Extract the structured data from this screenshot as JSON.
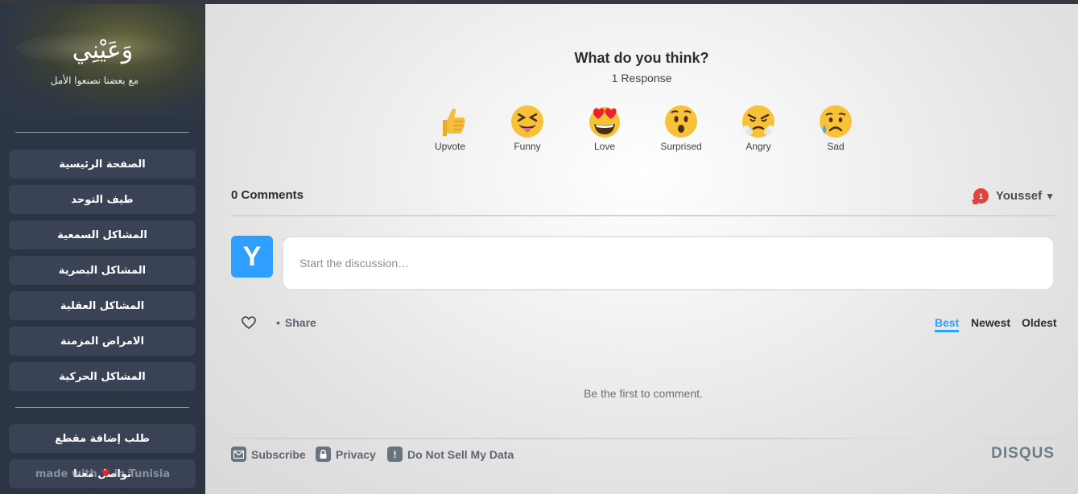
{
  "sidebar": {
    "brand": "وَعَيْنِي",
    "tagline": "مع بعضنا نصنعوا الأمل",
    "nav": [
      {
        "label": "الصفحة الرئيسية"
      },
      {
        "label": "طيف التوحد"
      },
      {
        "label": "المشاكل السمعية"
      },
      {
        "label": "المشاكل البصرية"
      },
      {
        "label": "المشاكل العقلية"
      },
      {
        "label": "الامراض المزمنة"
      },
      {
        "label": "المشاكل الحركية"
      }
    ],
    "request_clip": "طلب إضافة مقطع",
    "contact": "تواصل معنا",
    "made_with_prefix": "made with",
    "made_with_suffix": "in Tunisia"
  },
  "reactions_panel": {
    "question": "What do you think?",
    "responses": "1 Response",
    "reactions": [
      {
        "label": "Upvote",
        "icon": "thumbs-up-icon"
      },
      {
        "label": "Funny",
        "icon": "squinting-tongue-face-icon"
      },
      {
        "label": "Love",
        "icon": "heart-eyes-face-icon"
      },
      {
        "label": "Surprised",
        "icon": "hushed-face-icon"
      },
      {
        "label": "Angry",
        "icon": "steam-face-icon"
      },
      {
        "label": "Sad",
        "icon": "sad-sweat-face-icon"
      }
    ]
  },
  "comments": {
    "count_label": "0 Comments",
    "user_name": "Youssef",
    "notification_count": "1",
    "avatar_letter": "Y",
    "input_placeholder": "Start the discussion…",
    "share_label": "Share",
    "sort_options": [
      "Best",
      "Newest",
      "Oldest"
    ],
    "sort_selected": "Best",
    "empty_message": "Be the first to comment."
  },
  "footer": {
    "subscribe": "Subscribe",
    "privacy": "Privacy",
    "do_not_sell": "Do Not Sell My Data",
    "brand": "DISQUS"
  },
  "colors": {
    "accent": "#2e9fff",
    "sidebar_bg": "#2c3544",
    "nav_button": "#3a4355",
    "notification": "#e2423c"
  }
}
